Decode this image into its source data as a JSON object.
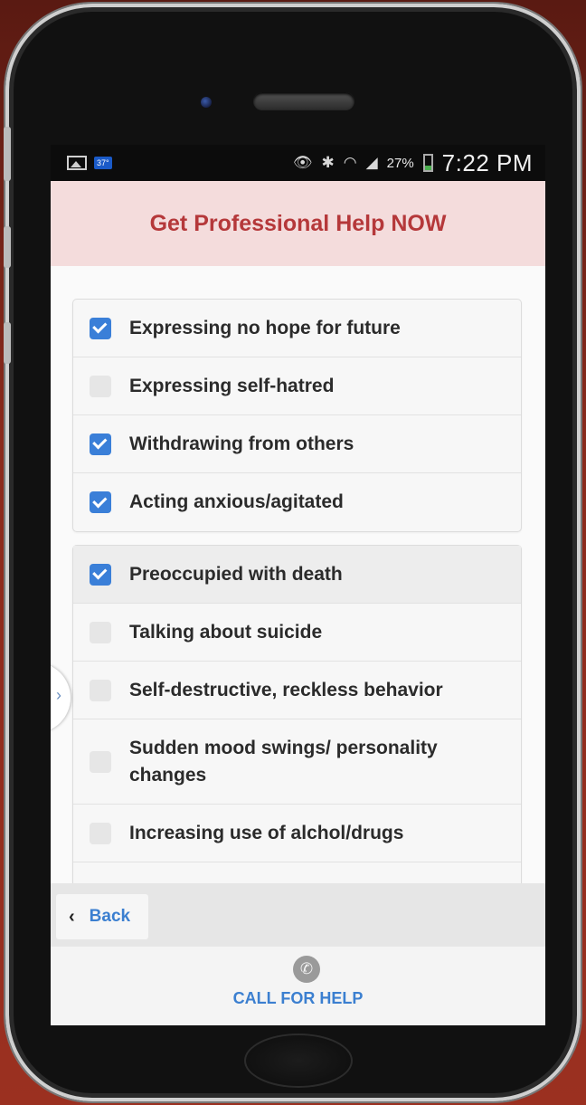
{
  "status_bar": {
    "temperature": "37°",
    "battery_percent": "27%",
    "time": "7:22 PM",
    "icons": [
      "image-icon",
      "weather-icon",
      "eye-icon",
      "bluetooth-icon",
      "wifi-icon",
      "signal-icon",
      "battery-icon"
    ]
  },
  "header": {
    "title": "Get Professional Help NOW"
  },
  "checklist": {
    "group1": [
      {
        "label": "Expressing no hope for future",
        "checked": true
      },
      {
        "label": "Expressing self-hatred",
        "checked": false
      },
      {
        "label": "Withdrawing from others",
        "checked": true
      },
      {
        "label": "Acting anxious/agitated",
        "checked": true
      }
    ],
    "group2": [
      {
        "label": "Preoccupied with death",
        "checked": true
      },
      {
        "label": "Talking about suicide",
        "checked": false
      },
      {
        "label": "Self-destructive, reckless behavior",
        "checked": false
      },
      {
        "label": "Sudden mood swings/ personality changes",
        "checked": false
      },
      {
        "label": "Increasing use of alchol/drugs",
        "checked": false
      }
    ]
  },
  "nav": {
    "back_label": "Back"
  },
  "footer": {
    "call_label": "CALL FOR HELP"
  },
  "colors": {
    "accent": "#3a7fd8",
    "header_bg": "#f4dcdc",
    "header_text": "#b5383a"
  }
}
